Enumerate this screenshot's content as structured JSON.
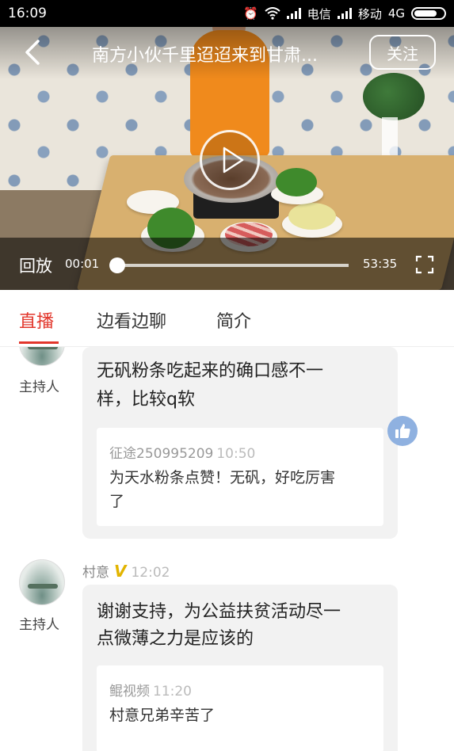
{
  "status_bar": {
    "time": "16:09",
    "carrier1": "电信",
    "carrier2": "移动",
    "network": "4G"
  },
  "video": {
    "title": "南方小伙千里迢迢来到甘肃...",
    "follow_label": "关注",
    "replay_label": "回放",
    "current_time": "00:01",
    "total_time": "53:35",
    "progress_fraction": 0.0003
  },
  "tabs": [
    {
      "label": "直播",
      "active": true
    },
    {
      "label": "边看边聊",
      "active": false
    },
    {
      "label": "简介",
      "active": false
    }
  ],
  "feed": [
    {
      "role": "主持人",
      "text_lines": [
        "无矾粉条吃起来的确口感不一",
        "样，比较q软"
      ],
      "quote": {
        "user": "征途250995209",
        "time": "10:50",
        "lines": [
          "为天水粉条点赞！无矾，好吃厉害",
          "了"
        ]
      }
    },
    {
      "poster": "村意",
      "badge": "V",
      "post_time": "12:02",
      "role": "主持人",
      "text_lines": [
        "谢谢支持，为公益扶贫活动尽一",
        "点微薄之力是应该的"
      ],
      "quote": {
        "user": "鲲视频",
        "time": "11:20",
        "lines": [
          "村意兄弟辛苦了"
        ]
      }
    }
  ],
  "colors": {
    "accent": "#e2362b",
    "bubble": "#f2f2f2",
    "like": "#8fb1e0",
    "vip": "#e2b400"
  },
  "icons": [
    "back-chevron-icon",
    "play-icon",
    "fullscreen-icon",
    "thumbs-up-icon",
    "alarm-icon",
    "wifi-icon",
    "signal-icon",
    "battery-icon"
  ]
}
